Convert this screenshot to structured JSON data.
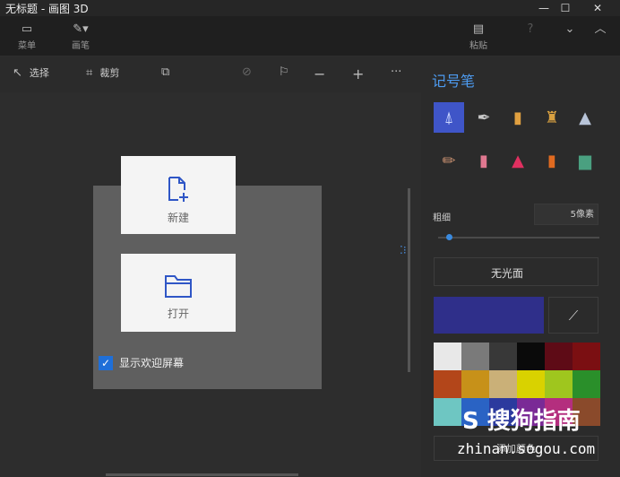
{
  "window": {
    "title": "无标题 - 画图 3D",
    "controls": [
      "—",
      "☐",
      "✕"
    ]
  },
  "topbar": {
    "menu_label": "菜单",
    "brushes_label": "画笔",
    "paste_label": "粘贴"
  },
  "toolbar": {
    "select_label": "选择",
    "crop_label": "裁剪"
  },
  "welcome_dialog": {
    "new_label": "新建",
    "open_label": "打开",
    "show_welcome_label": "显示欢迎屏幕"
  },
  "panel": {
    "title": "记号笔",
    "thickness_label": "粗细",
    "thickness_value": "5像素",
    "thickness_level": 0.05,
    "finish_value": "无光面",
    "current_color": "#2f2f8a",
    "add_color_label": "添加颜色"
  },
  "palette": [
    [
      "#e8e8e8",
      "#7a7a7a",
      "#383838",
      "#0a0a0a",
      "#5e0b16",
      "#7b0f12"
    ],
    [
      "#b3461a",
      "#c79119",
      "#cab078",
      "#d9d200",
      "#9fc61e",
      "#2a8f2a"
    ],
    [
      "#6ec6c2",
      "#2a63c4",
      "#2b3a9e",
      "#7a2a96",
      "#b42e7e",
      "#8a4a2b"
    ]
  ],
  "watermark": {
    "logo": "S 搜狗指南",
    "site": "zhinan.sogou.com"
  }
}
